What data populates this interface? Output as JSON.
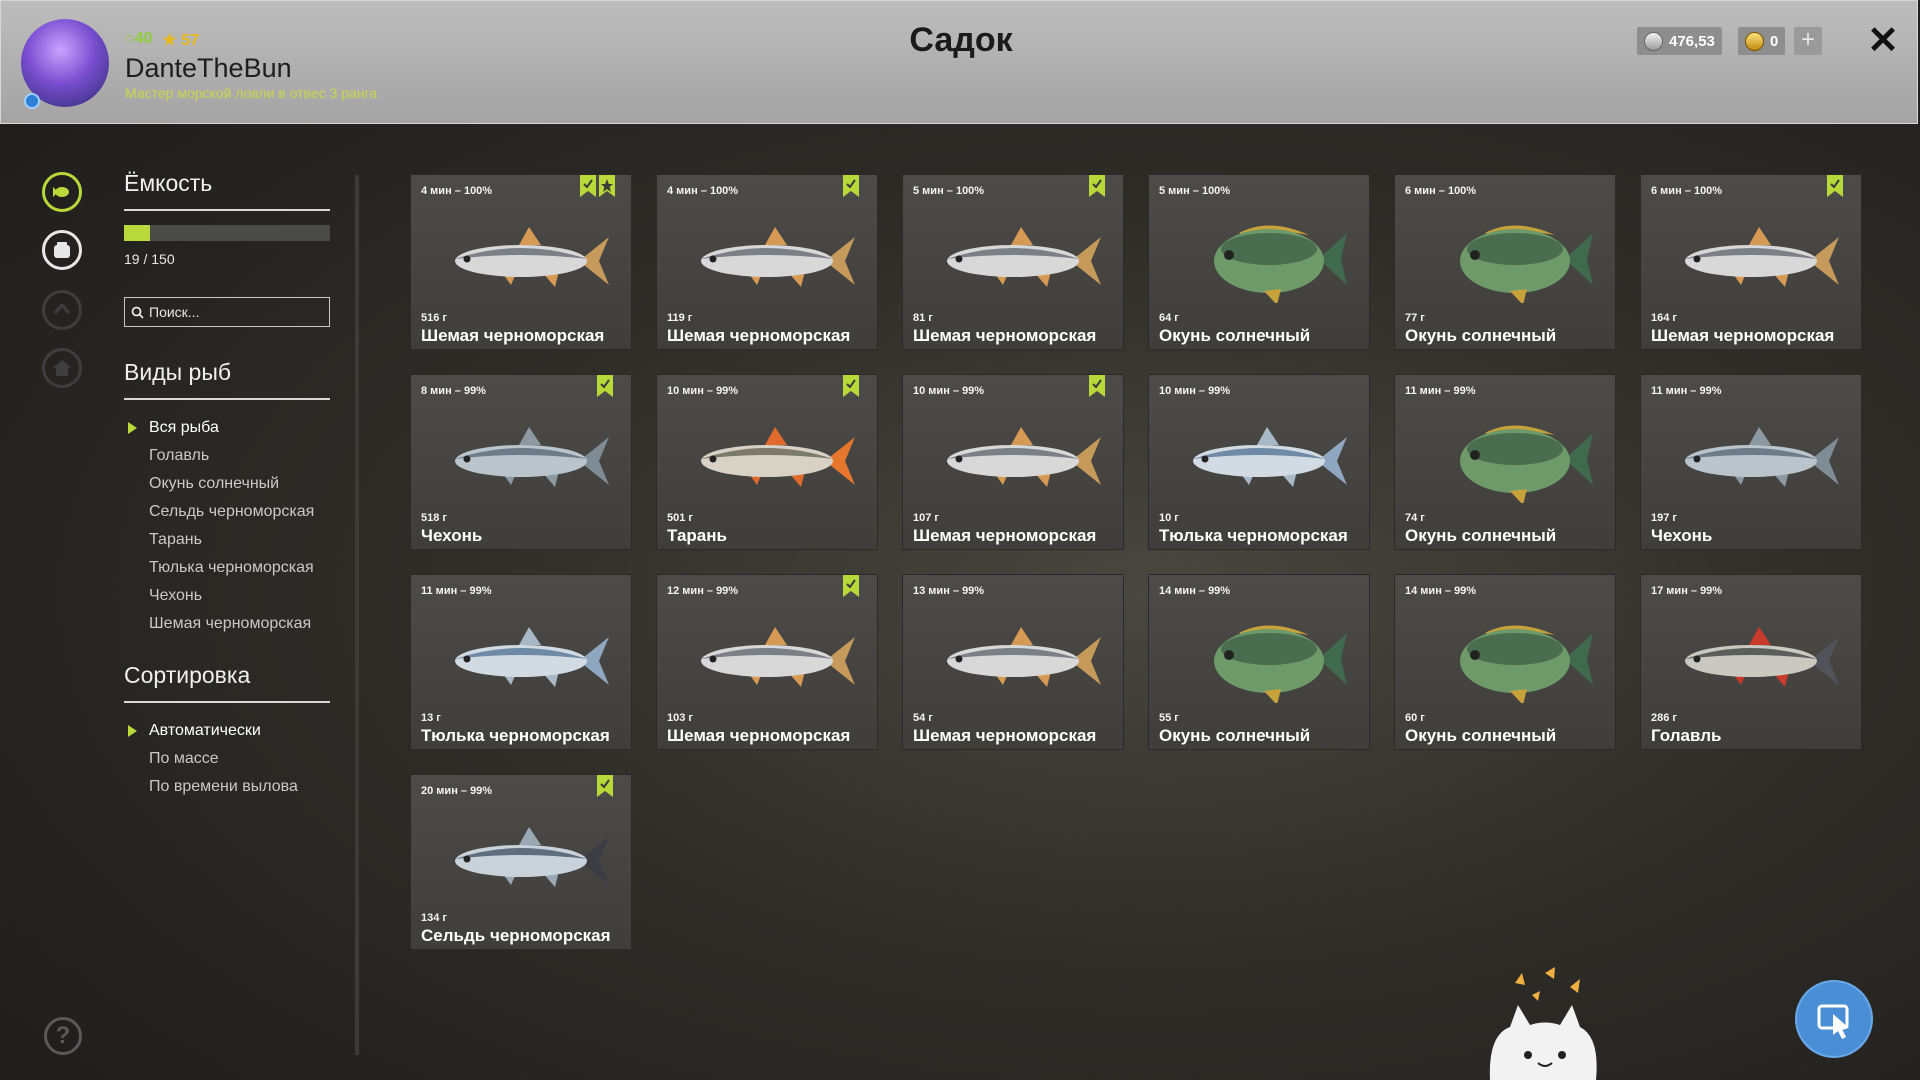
{
  "header": {
    "level": "40",
    "stars": "57",
    "player_name": "DanteTheBun",
    "player_rank": "Мастер морской ловли в отвес 3 ранга",
    "title": "Садок",
    "silver": "476,53",
    "gold": "0",
    "plus_label": "+",
    "close_label": "✕"
  },
  "capacity": {
    "heading": "Ёмкость",
    "text": "19 / 150",
    "used": 19,
    "max": 150
  },
  "search": {
    "placeholder": "Поиск..."
  },
  "species": {
    "heading": "Виды рыб",
    "items": [
      "Вся рыба",
      "Голавль",
      "Окунь солнечный",
      "Сельдь черноморская",
      "Тарань",
      "Тюлька черноморская",
      "Чехонь",
      "Шемая черноморская"
    ],
    "active": 0
  },
  "sorting": {
    "heading": "Сортировка",
    "items": [
      "Автоматически",
      "По массе",
      "По времени вылова"
    ],
    "active": 0
  },
  "help_label": "?",
  "colors": {
    "accent": "#b9d83a",
    "bookmark": "#b9d83a",
    "cursor_button": "#4a8fd6"
  },
  "fish": [
    {
      "time": "4 мин – 100%",
      "weight": "516 г",
      "name": "Шемая черноморская",
      "type": "shemaya",
      "marks": [
        "check",
        "star"
      ]
    },
    {
      "time": "4 мин – 100%",
      "weight": "119 г",
      "name": "Шемая черноморская",
      "type": "shemaya",
      "marks": [
        "check"
      ]
    },
    {
      "time": "5 мин – 100%",
      "weight": "81 г",
      "name": "Шемая черноморская",
      "type": "shemaya",
      "marks": [
        "check"
      ]
    },
    {
      "time": "5 мин – 100%",
      "weight": "64 г",
      "name": "Окунь солнечный",
      "type": "sunfish",
      "marks": []
    },
    {
      "time": "6 мин – 100%",
      "weight": "77 г",
      "name": "Окунь солнечный",
      "type": "sunfish",
      "marks": []
    },
    {
      "time": "6 мин – 100%",
      "weight": "164 г",
      "name": "Шемая черноморская",
      "type": "shemaya",
      "marks": [
        "check"
      ]
    },
    {
      "time": "8 мин – 99%",
      "weight": "518 г",
      "name": "Чехонь",
      "type": "chekhon",
      "marks": [
        "check"
      ]
    },
    {
      "time": "10 мин – 99%",
      "weight": "501 г",
      "name": "Тарань",
      "type": "taran",
      "marks": [
        "check"
      ]
    },
    {
      "time": "10 мин – 99%",
      "weight": "107 г",
      "name": "Шемая черноморская",
      "type": "shemaya",
      "marks": [
        "check"
      ]
    },
    {
      "time": "10 мин – 99%",
      "weight": "10 г",
      "name": "Тюлька черноморская",
      "type": "tyulka",
      "marks": []
    },
    {
      "time": "11 мин – 99%",
      "weight": "74 г",
      "name": "Окунь солнечный",
      "type": "sunfish",
      "marks": []
    },
    {
      "time": "11 мин – 99%",
      "weight": "197 г",
      "name": "Чехонь",
      "type": "chekhon",
      "marks": []
    },
    {
      "time": "11 мин – 99%",
      "weight": "13 г",
      "name": "Тюлька черноморская",
      "type": "tyulka",
      "marks": []
    },
    {
      "time": "12 мин – 99%",
      "weight": "103 г",
      "name": "Шемая черноморская",
      "type": "shemaya",
      "marks": [
        "check"
      ]
    },
    {
      "time": "13 мин – 99%",
      "weight": "54 г",
      "name": "Шемая черноморская",
      "type": "shemaya",
      "marks": []
    },
    {
      "time": "14 мин – 99%",
      "weight": "55 г",
      "name": "Окунь солнечный",
      "type": "sunfish",
      "marks": []
    },
    {
      "time": "14 мин – 99%",
      "weight": "60 г",
      "name": "Окунь солнечный",
      "type": "sunfish",
      "marks": []
    },
    {
      "time": "17 мин – 99%",
      "weight": "286 г",
      "name": "Голавль",
      "type": "golavl",
      "marks": []
    },
    {
      "time": "20 мин – 99%",
      "weight": "134 г",
      "name": "Сельдь черноморская",
      "type": "seld",
      "marks": [
        "check"
      ]
    }
  ]
}
